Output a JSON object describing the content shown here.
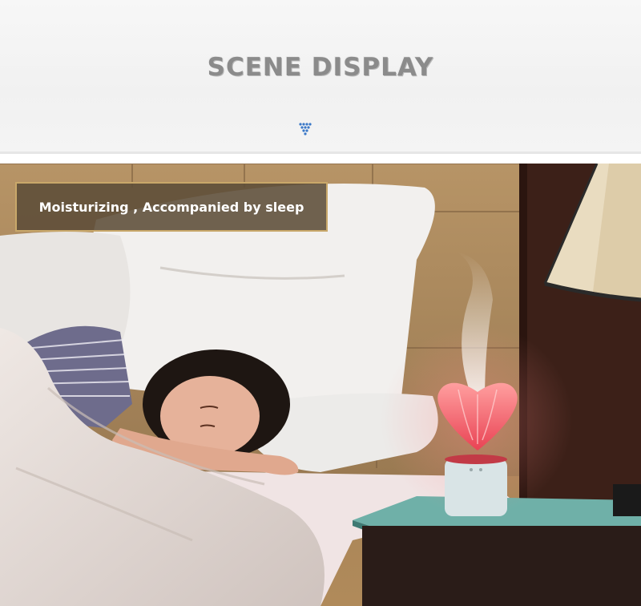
{
  "header": {
    "title": "SCENE DISPLAY",
    "arrow_icon": "down-triangle-dots-icon"
  },
  "scene": {
    "caption": "Moisturizing , Accompanied by sleep",
    "accent_color": "#f0606a",
    "caption_border_color": "#c9a86a"
  }
}
